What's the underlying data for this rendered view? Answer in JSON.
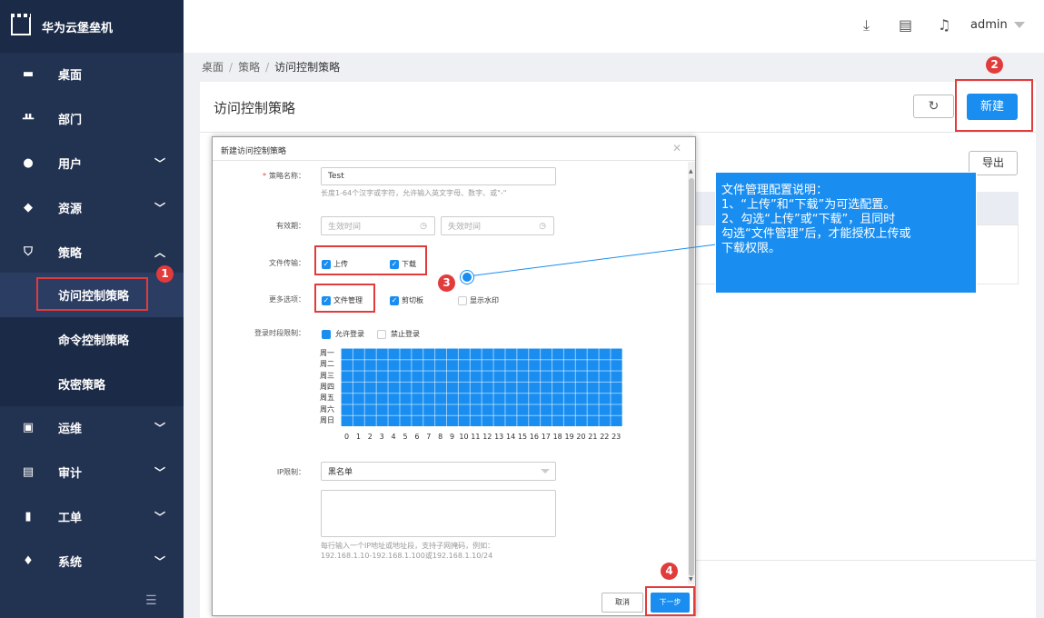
{
  "app": {
    "name": "华为云堡垒机"
  },
  "sidebar": {
    "items": [
      {
        "label": "桌面",
        "icon": "monitor-icon"
      },
      {
        "label": "部门",
        "icon": "org-chart-icon"
      },
      {
        "label": "用户",
        "icon": "user-icon"
      },
      {
        "label": "资源",
        "icon": "layers-icon"
      },
      {
        "label": "策略",
        "icon": "shield-icon"
      },
      {
        "label": "运维",
        "icon": "ops-icon"
      },
      {
        "label": "审计",
        "icon": "clipboard-icon"
      },
      {
        "label": "工单",
        "icon": "document-icon"
      },
      {
        "label": "系统",
        "icon": "diamond-icon"
      }
    ],
    "policy_sub": [
      "访问控制策略",
      "命令控制策略",
      "改密策略"
    ]
  },
  "topbar": {
    "user": "admin"
  },
  "breadcrumb": [
    "桌面",
    "策略",
    "访问控制策略"
  ],
  "page": {
    "title": "访问控制策略",
    "new_label": "新建",
    "export_label": "导出"
  },
  "modal": {
    "title": "新建访问控制策略",
    "name_label": "策略名称：",
    "name_value": "Test",
    "name_hint": "长度1-64个汉字或字符，允许输入英文字母、数字、或\"-\"",
    "validity_label": "有效期：",
    "start_placeholder": "生效时间",
    "end_placeholder": "失效时间",
    "transfer_label": "文件传输：",
    "upload_label": "上传",
    "download_label": "下载",
    "more_label": "更多选项：",
    "file_mgmt_label": "文件管理",
    "clipboard_label": "剪切板",
    "watermark_label": "显示水印",
    "login_time_label": "登录时段限制：",
    "allow_login_label": "允许登录",
    "deny_login_label": "禁止登录",
    "days": [
      "周一",
      "周二",
      "周三",
      "周四",
      "周五",
      "周六",
      "周日"
    ],
    "hours": [
      "0",
      "1",
      "2",
      "3",
      "4",
      "5",
      "6",
      "7",
      "8",
      "9",
      "10",
      "11",
      "12",
      "13",
      "14",
      "15",
      "16",
      "17",
      "18",
      "19",
      "20",
      "21",
      "22",
      "23"
    ],
    "ip_label": "IP限制：",
    "ip_mode": "黑名单",
    "ip_hint_1": "每行输入一个IP地址或地址段，支持子网掩码，例如：",
    "ip_hint_2": "192.168.1.10-192.168.1.100或192.168.1.10/24",
    "cancel_label": "取消",
    "next_label": "下一步"
  },
  "callout": {
    "lines": [
      "文件管理配置说明：",
      "1、“上传”和“下载”为可选配置。",
      "2、勾选“上传”或“下载”，且同时",
      "勾选“文件管理”后，才能授权上传或",
      "下载权限。"
    ]
  },
  "steps": [
    "1",
    "2",
    "3",
    "4"
  ],
  "colors": {
    "accent": "#1a8ef0",
    "sidebar": "#223251",
    "highlight": "#e23b3b"
  }
}
